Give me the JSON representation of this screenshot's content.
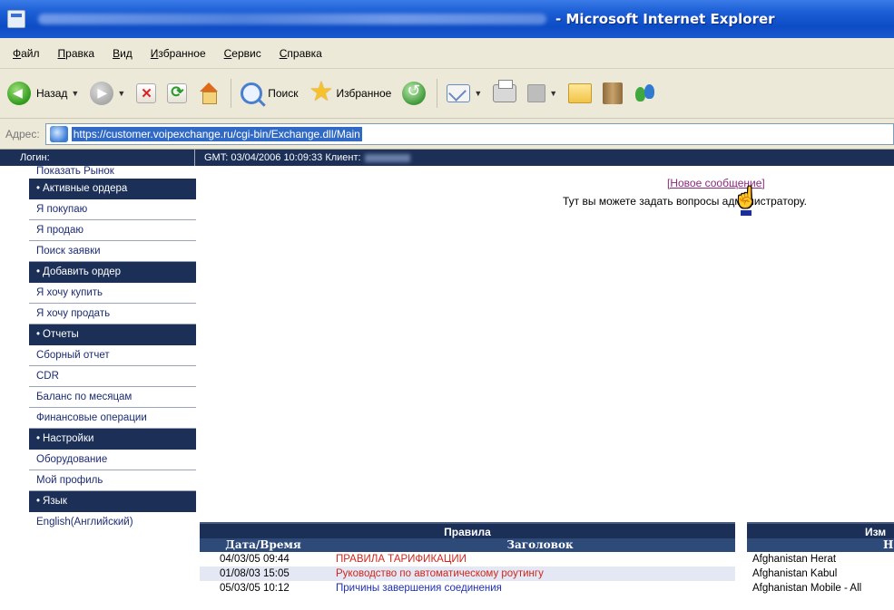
{
  "window": {
    "title_suffix": "- Microsoft Internet Explorer"
  },
  "menu": [
    "Файл",
    "Правка",
    "Вид",
    "Избранное",
    "Сервис",
    "Справка"
  ],
  "toolbar": {
    "back_label": "Назад",
    "search_label": "Поиск",
    "favorites_label": "Избранное"
  },
  "address": {
    "label": "Адрес:",
    "url": "https://customer.voipexchange.ru/cgi-bin/Exchange.dll/Main"
  },
  "header": {
    "login_label": "Логин:",
    "info": "GMT: 03/04/2006 10:09:33  Клиент:"
  },
  "sidebar": [
    {
      "label": "Показать Рынок",
      "type": "top"
    },
    {
      "label": "Активные ордера",
      "type": "head"
    },
    {
      "label": "Я покупаю",
      "type": "item"
    },
    {
      "label": "Я продаю",
      "type": "item"
    },
    {
      "label": "Поиск заявки",
      "type": "item"
    },
    {
      "label": "Добавить ордер",
      "type": "head"
    },
    {
      "label": "Я хочу купить",
      "type": "item"
    },
    {
      "label": "Я хочу продать",
      "type": "item"
    },
    {
      "label": "Отчеты",
      "type": "head"
    },
    {
      "label": "Сборный отчет",
      "type": "item"
    },
    {
      "label": "CDR",
      "type": "item"
    },
    {
      "label": "Баланс по месяцам",
      "type": "item"
    },
    {
      "label": "Финансовые операции",
      "type": "item"
    },
    {
      "label": "Настройки",
      "type": "head"
    },
    {
      "label": "Оборудование",
      "type": "item"
    },
    {
      "label": "Мой профиль",
      "type": "item"
    },
    {
      "label": "Язык",
      "type": "head"
    },
    {
      "label": "English(Английский)",
      "type": "plain"
    }
  ],
  "content": {
    "new_message_link": "[Новое сообщение]",
    "info_text": "Тут вы можете задать вопросы администратору."
  },
  "rules_table": {
    "title": "Правила",
    "col_date": "Дата/Время",
    "col_title": "Заголовок",
    "rows": [
      {
        "date": "04/03/05 09:44",
        "title": "ПРАВИЛА ТАРИФИКАЦИИ"
      },
      {
        "date": "01/08/03 15:05",
        "title": "Руководство по автоматическому роутингу"
      },
      {
        "date": "05/03/05 10:12",
        "title": "Причины завершения соединения"
      }
    ]
  },
  "changes_table": {
    "title": "Изм",
    "col": "Н",
    "rows": [
      "Afghanistan Herat",
      "Afghanistan Kabul",
      "Afghanistan Mobile - All"
    ]
  }
}
